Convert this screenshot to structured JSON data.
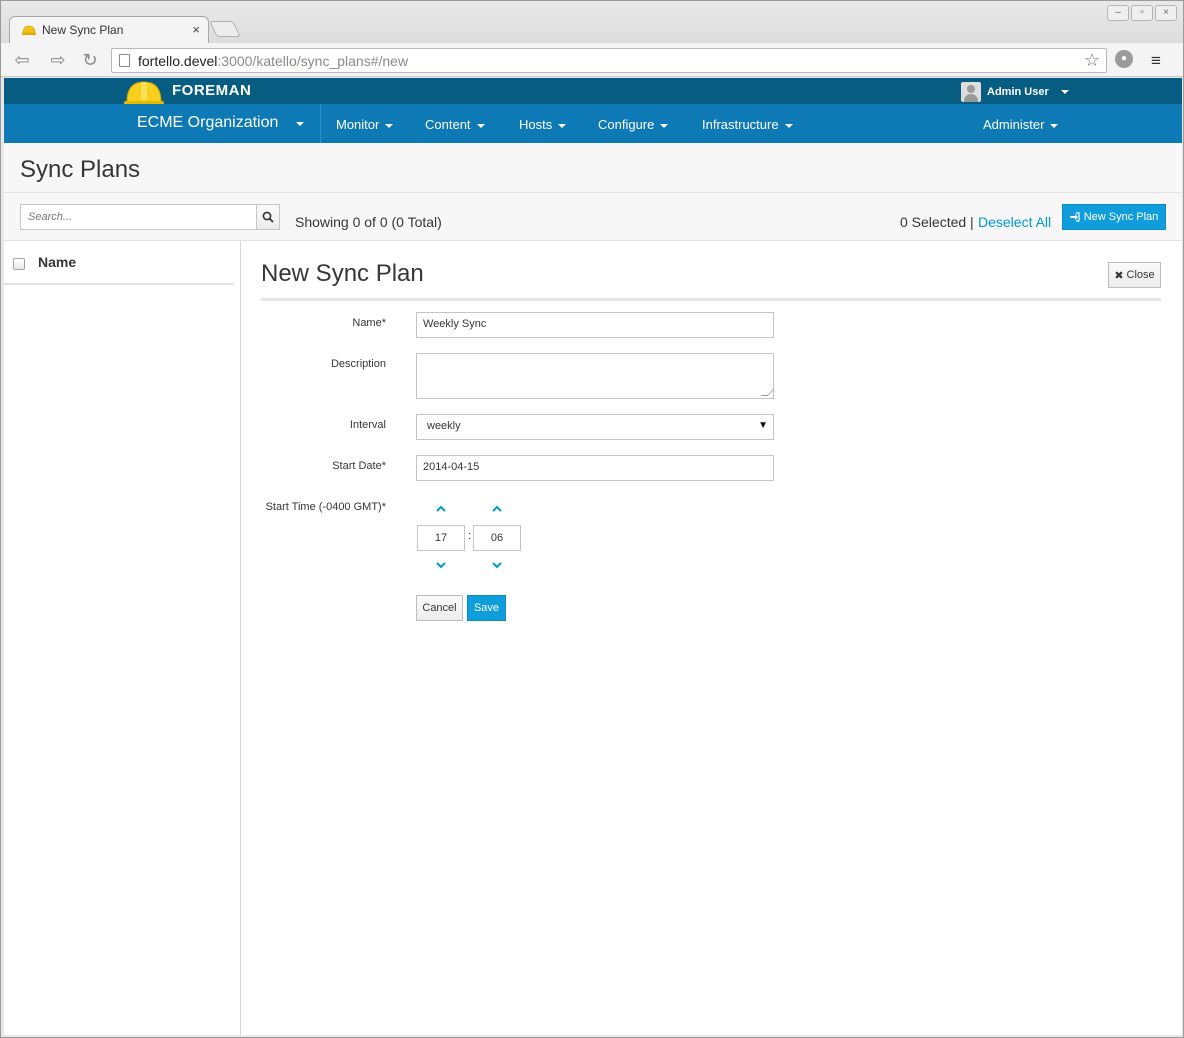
{
  "browser": {
    "tab_title": "New Sync Plan",
    "tab_close": "×",
    "url_host": "fortello.devel",
    "url_path": ":3000/katello/sync_plans#/new",
    "star_icon": "☆",
    "menu_icon": "≡"
  },
  "header": {
    "brand": "FOREMAN",
    "user": "Admin User"
  },
  "nav": {
    "organization": "ECME Organization",
    "items": [
      "Monitor",
      "Content",
      "Hosts",
      "Configure",
      "Infrastructure"
    ],
    "administer": "Administer"
  },
  "page": {
    "title": "Sync Plans",
    "search_placeholder": "Search...",
    "showing": "Showing 0 of 0 (0 Total)",
    "selected": "0 Selected |",
    "deselect_all": "Deselect All",
    "new_button": "New Sync Plan",
    "column_name": "Name"
  },
  "form": {
    "title": "New Sync Plan",
    "close_label": "Close",
    "name_label": "Name*",
    "name_value": "Weekly Sync",
    "description_label": "Description",
    "description_value": "",
    "interval_label": "Interval",
    "interval_value": "weekly",
    "start_date_label": "Start Date*",
    "start_date_value": "2014-04-15",
    "start_time_label": "Start Time (-0400 GMT)*",
    "hours": "17",
    "minutes": "06",
    "time_separator": ":",
    "cancel_label": "Cancel",
    "save_label": "Save"
  },
  "colors": {
    "topbar": "#075c82",
    "navbar": "#0e7ab5",
    "primary_button": "#0f9ddb",
    "link": "#0099d3"
  }
}
